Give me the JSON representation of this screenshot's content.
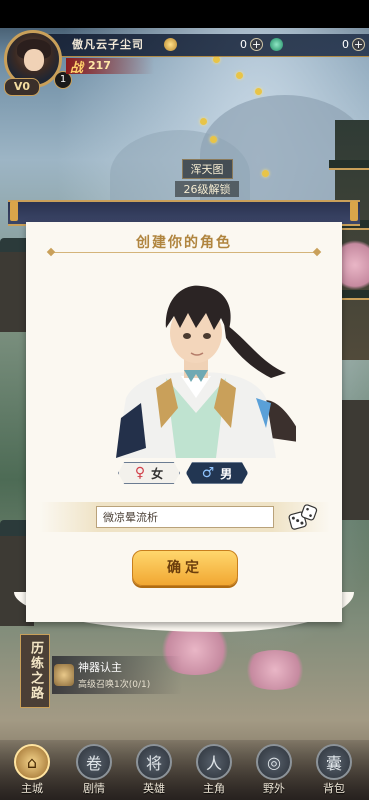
{
  "hud": {
    "player_name": "傲凡云子尘司",
    "vip": "V0",
    "level": "1",
    "power_label": "战",
    "power_value": "217",
    "currency1_value": "0",
    "currency2_value": "0",
    "plus": "+"
  },
  "map": {
    "location_name": "浑天图",
    "unlock_hint": "26级解锁"
  },
  "dialog": {
    "title": "创建你的角色",
    "gender_female": "女",
    "gender_male": "男",
    "gender_female_symbol": "♀",
    "gender_male_symbol": "♂",
    "name_value": "微凉晕流析",
    "confirm_label": "确定",
    "selected_gender": "male"
  },
  "quest": {
    "tag": "历练之路",
    "title": "神器认主",
    "progress": "高级召唤1次(0/1)"
  },
  "nav": {
    "items": [
      {
        "label": "主城",
        "icon": "city-icon",
        "glyph": "⌂"
      },
      {
        "label": "剧情",
        "icon": "story-icon",
        "glyph": "卷"
      },
      {
        "label": "英雄",
        "icon": "heroes-icon",
        "glyph": "将"
      },
      {
        "label": "主角",
        "icon": "protagonist-icon",
        "glyph": "人"
      },
      {
        "label": "野外",
        "icon": "wild-icon",
        "glyph": "◎"
      },
      {
        "label": "背包",
        "icon": "bag-icon",
        "glyph": "囊"
      }
    ],
    "active_index": 0
  },
  "colors": {
    "accent_gold": "#c9a05a",
    "confirm": "#f1a732",
    "male_selected": "#223652"
  }
}
